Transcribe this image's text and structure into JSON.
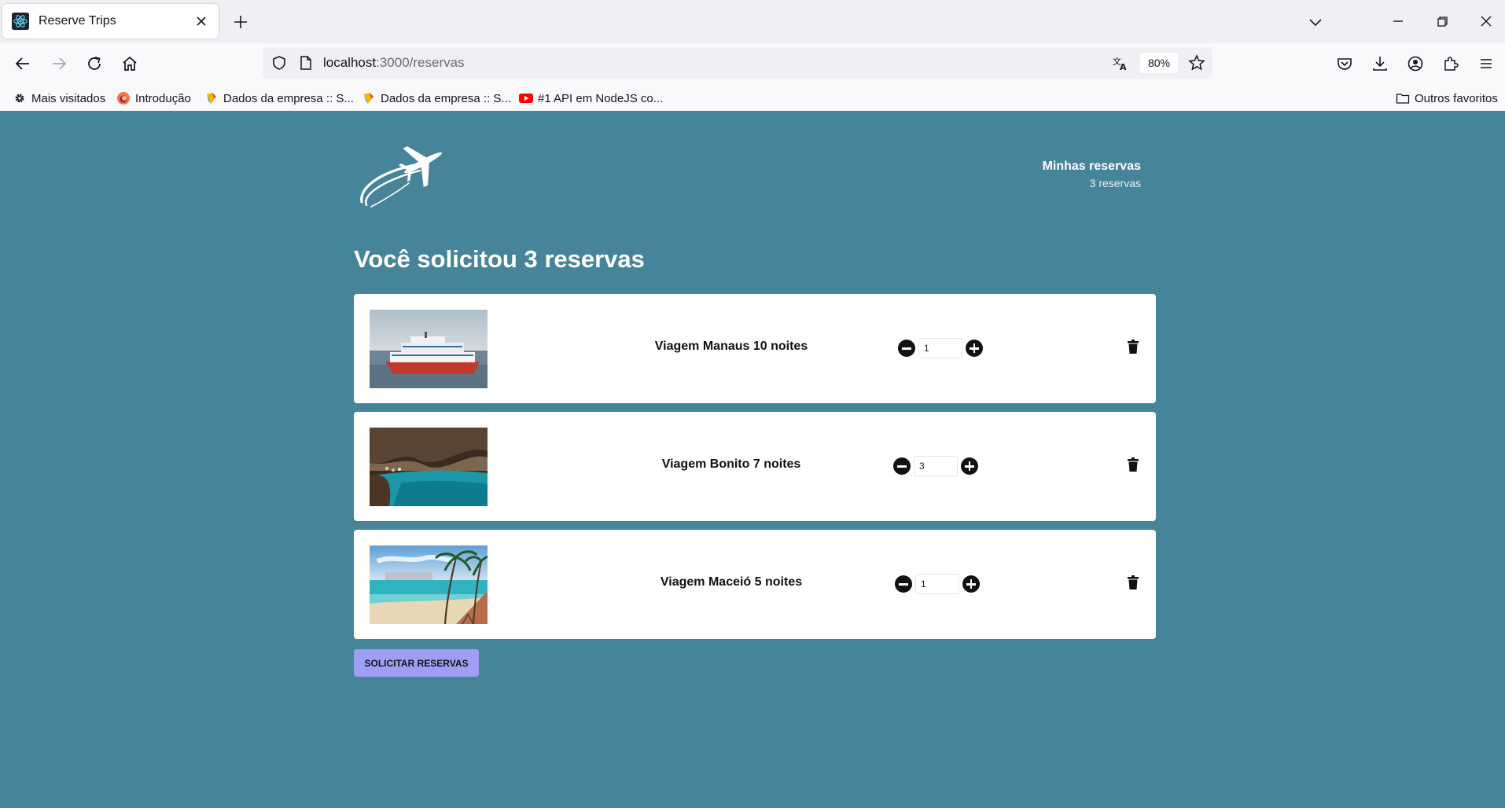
{
  "browser": {
    "tab_title": "Reserve Trips",
    "url_host": "localhost",
    "url_path": ":3000/reservas",
    "zoom": "80%",
    "bookmarks": [
      {
        "label": "Mais visitados",
        "icon": "gear-icon"
      },
      {
        "label": "Introdução",
        "icon": "firefox-icon"
      },
      {
        "label": "Dados da empresa :: S...",
        "icon": "company-icon"
      },
      {
        "label": "Dados da empresa :: S...",
        "icon": "company-icon"
      },
      {
        "label": "#1 API em NodeJS co...",
        "icon": "youtube-icon"
      }
    ],
    "other_bookmarks": "Outros favoritos"
  },
  "header": {
    "my_reservations_title": "Minhas reservas",
    "my_reservations_count": "3 reservas"
  },
  "main": {
    "heading": "Você solicitou 3 reservas",
    "reservations": [
      {
        "title": "Viagem Manaus 10 noites",
        "quantity": "1",
        "image": "boat-photo"
      },
      {
        "title": "Viagem Bonito 7 noites",
        "quantity": "3",
        "image": "cave-photo"
      },
      {
        "title": "Viagem Maceió 5 noites",
        "quantity": "1",
        "image": "beach-photo"
      }
    ],
    "submit_label": "SOLICITAR RESERVAS"
  },
  "colors": {
    "page_background": "#468499",
    "submit_button": "#9e9ef5"
  }
}
